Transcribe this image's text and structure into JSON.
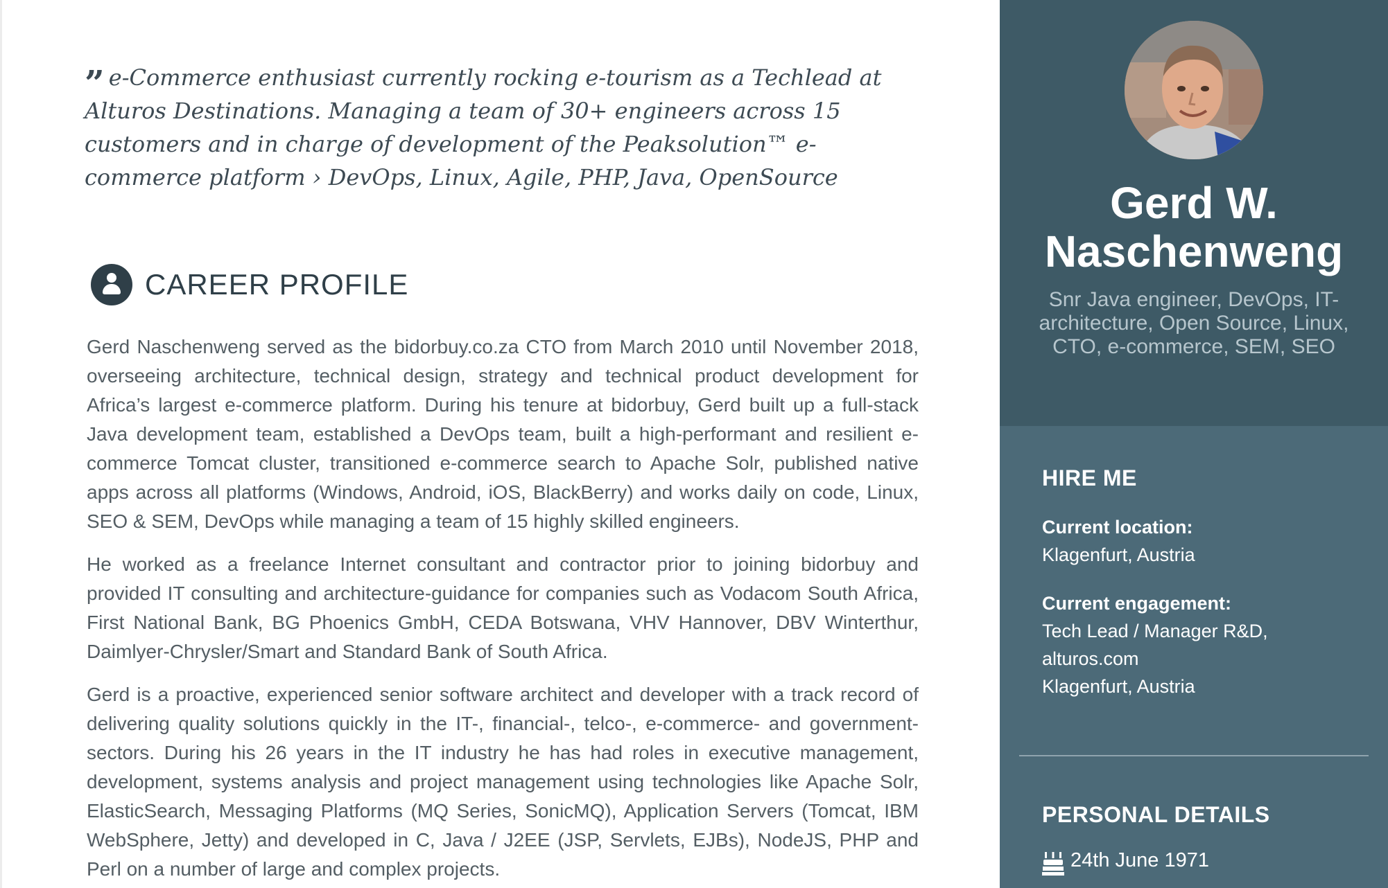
{
  "intro": {
    "quote": "e-Commerce enthusiast currently rocking e-tourism as a Techlead at Alturos Destinations. Managing a team of 30+ engineers across 15 customers and in charge of development of the Peaksolution™ e-commerce platform › DevOps, Linux, Agile, PHP, Java, OpenSource",
    "quote_icon": "quote-icon"
  },
  "career": {
    "title": "CAREER PROFILE",
    "icon": "user-icon",
    "paragraphs": [
      "Gerd Naschenweng served as the bidorbuy.co.za CTO from March 2010 until November 2018, overseeing architecture, technical design, strategy and technical product development for Africa’s largest e-commerce platform. During his tenure at bidorbuy, Gerd built up a full-stack Java development team, established a DevOps team, built a high-performant and resilient e-commerce Tomcat cluster, transitioned e-commerce search to Apache Solr, published native apps across all platforms (Windows, Android, iOS, BlackBerry) and works daily on code, Linux, SEO & SEM, DevOps while managing a team of 15 highly skilled engineers.",
      "He worked as a freelance Internet consultant and contractor prior to joining bidorbuy and provided IT consulting and architecture-guidance for companies such as Vodacom South Africa, First National Bank, BG Phoenics GmbH, CEDA Botswana, VHV Hannover, DBV Winterthur, Daimlyer-Chrysler/Smart and Standard Bank of South Africa.",
      "Gerd is a proactive, experienced senior software architect and developer with a track record of delivering quality solutions quickly in the IT-, financial-, telco-, e-commerce- and government-sectors. During his 26 years in the IT industry he has had roles in executive management, development, systems analysis and project management using technologies like Apache Solr, ElasticSearch, Messaging Platforms (MQ Series, SonicMQ), Application Servers (Tomcat, IBM WebSphere, Jetty) and developed in C, Java / J2EE (JSP, Servlets, EJBs), NodeJS, PHP and Perl on a number of large and complex projects."
    ]
  },
  "sidebar": {
    "name": "Gerd W. Naschenweng",
    "tagline": "Snr Java engineer, DevOps, IT-architecture, Open Source, Linux, CTO, e-commerce, SEM, SEO",
    "hire_me": {
      "title": "HIRE ME",
      "location_label": "Current location:",
      "location": "Klagenfurt, Austria",
      "engagement_label": "Current engagement:",
      "engagement_lines": [
        "Tech Lead / Manager R&D,",
        "alturos.com",
        "Klagenfurt, Austria"
      ]
    },
    "personal": {
      "title": "PERSONAL DETAILS",
      "birthday_icon": "birthday-cake-icon",
      "birthday": "24th June 1971"
    }
  },
  "colors": {
    "sidebar_dark": "#3e5a66",
    "sidebar_light": "#4c6a78",
    "heading": "#2f3f48",
    "body_text": "#545e64"
  }
}
